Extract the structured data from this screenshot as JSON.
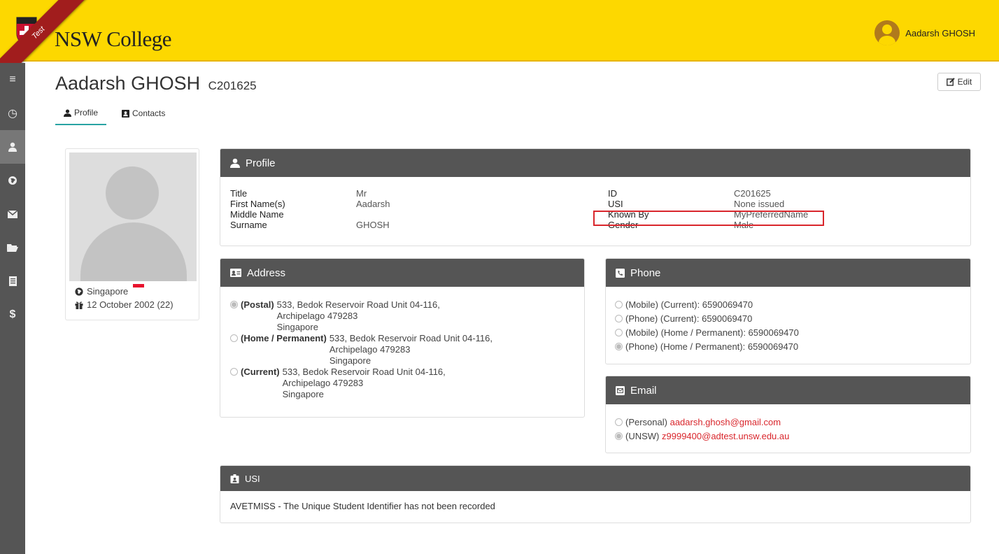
{
  "brand": {
    "name": "NSW College",
    "ribbon": "Test"
  },
  "user": {
    "name": "Aadarsh GHOSH"
  },
  "sidebar": {
    "items": [
      {
        "icon": "menu-icon",
        "glyph": "≡"
      },
      {
        "icon": "dashboard-icon",
        "glyph": "◷"
      },
      {
        "icon": "user-icon",
        "glyph": "👤"
      },
      {
        "icon": "globe-icon",
        "glyph": "🌐"
      },
      {
        "icon": "envelope-icon",
        "glyph": "✉"
      },
      {
        "icon": "folder-icon",
        "glyph": "📂"
      },
      {
        "icon": "document-icon",
        "glyph": "▤"
      },
      {
        "icon": "dollar-icon",
        "glyph": "$"
      }
    ]
  },
  "page": {
    "title": "Aadarsh GHOSH",
    "code": "C201625",
    "edit_label": "Edit"
  },
  "tabs": [
    {
      "label": "Profile"
    },
    {
      "label": "Contacts"
    }
  ],
  "card": {
    "country": "Singapore",
    "dob": "12 October 2002 (22)"
  },
  "profile": {
    "heading": "Profile",
    "left": [
      {
        "k": "Title",
        "v": "Mr"
      },
      {
        "k": "First Name(s)",
        "v": "Aadarsh"
      },
      {
        "k": "Middle Name",
        "v": ""
      },
      {
        "k": "Surname",
        "v": "GHOSH"
      }
    ],
    "right": [
      {
        "k": "ID",
        "v": "C201625"
      },
      {
        "k": "USI",
        "v": "None issued"
      },
      {
        "k": "Known By",
        "v": "MyPreferredName"
      },
      {
        "k": "Gender",
        "v": "Male"
      }
    ]
  },
  "address": {
    "heading": "Address",
    "items": [
      {
        "label": "(Postal)",
        "line1": "533, Bedok Reservoir Road Unit 04-116,",
        "line2": "Archipelago 479283",
        "line3": "Singapore",
        "checked": true
      },
      {
        "label": "(Home / Permanent)",
        "line1": "533, Bedok Reservoir Road Unit 04-116,",
        "line2": "Archipelago 479283",
        "line3": "Singapore",
        "checked": false
      },
      {
        "label": "(Current)",
        "line1": "533, Bedok Reservoir Road Unit 04-116,",
        "line2": "Archipelago 479283",
        "line3": "Singapore",
        "checked": false
      }
    ]
  },
  "phone": {
    "heading": "Phone",
    "items": [
      {
        "text": "(Mobile) (Current): 6590069470",
        "checked": false
      },
      {
        "text": "(Phone) (Current): 6590069470",
        "checked": false
      },
      {
        "text": "(Mobile) (Home / Permanent): 6590069470",
        "checked": false
      },
      {
        "text": "(Phone) (Home / Permanent): 6590069470",
        "checked": true
      }
    ]
  },
  "email": {
    "heading": "Email",
    "items": [
      {
        "label": "(Personal)",
        "address": "aadarsh.ghosh@gmail.com",
        "checked": false
      },
      {
        "label": "(UNSW)",
        "address": "z9999400@adtest.unsw.edu.au",
        "checked": true
      }
    ]
  },
  "usi": {
    "heading": "USI",
    "message": "AVETMISS - The Unique Student Identifier has not been recorded"
  },
  "colors": {
    "accent": "#fdd800",
    "panel_header": "#555555",
    "link": "#d9262c",
    "tab_underline": "#29a3a3"
  }
}
